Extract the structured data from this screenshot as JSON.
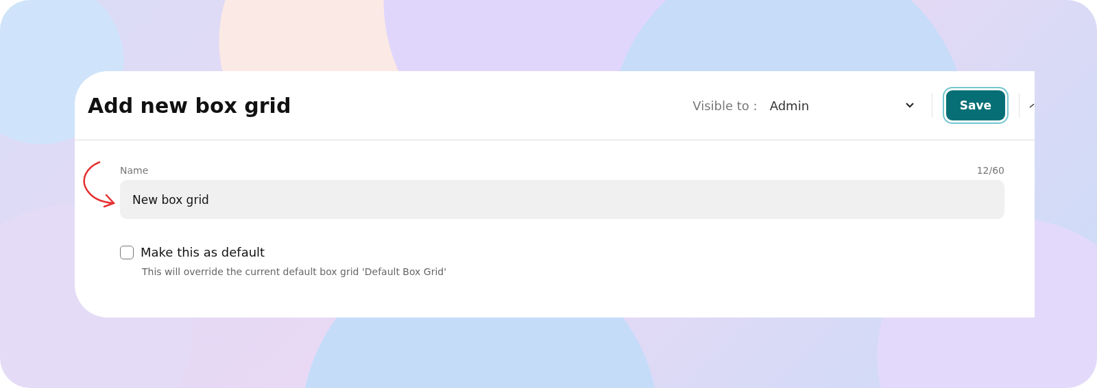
{
  "dialog": {
    "title": "Add new box grid",
    "visibility": {
      "label": "Visible to :",
      "value": "Admin"
    },
    "save_button": "Save",
    "name_field": {
      "label": "Name",
      "counter": "12/60",
      "value": "New box grid"
    },
    "default_option": {
      "label": "Make this as default",
      "checked": false,
      "description": "This will override the current default box grid 'Default Box Grid'"
    }
  }
}
